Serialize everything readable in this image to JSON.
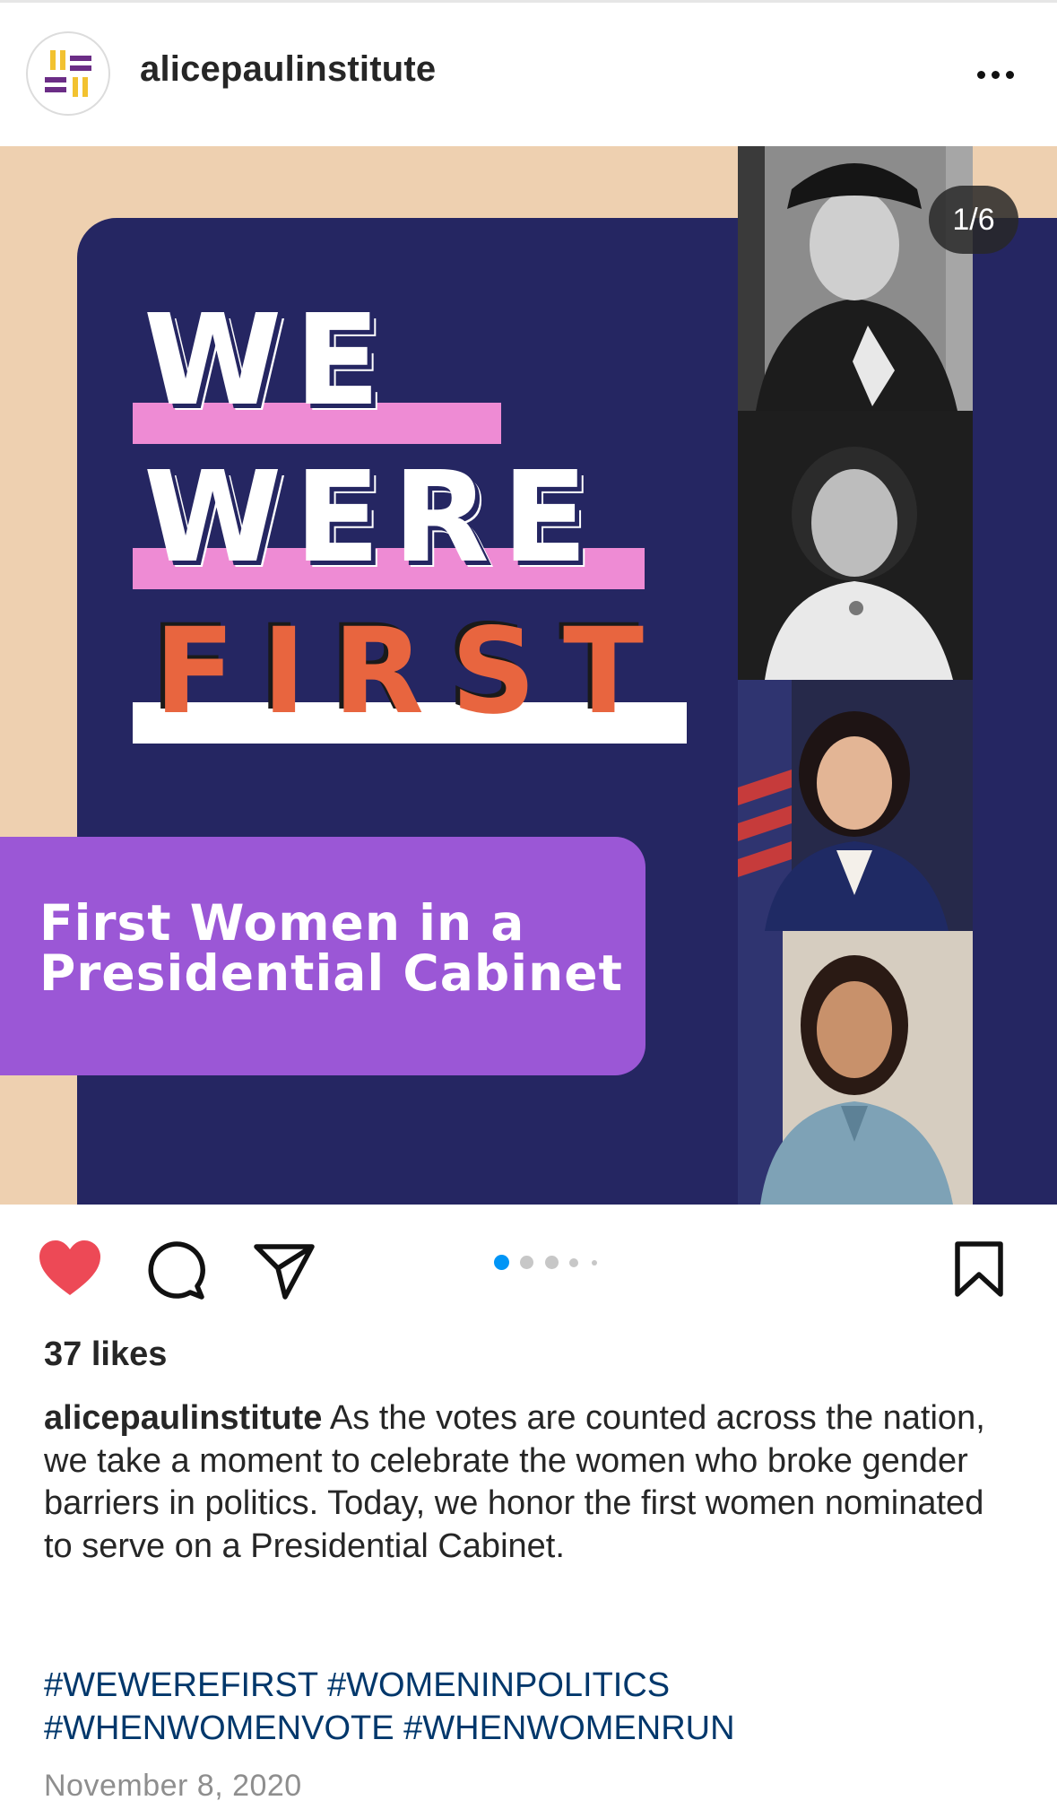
{
  "account": {
    "username": "alicepaulinstitute"
  },
  "post": {
    "slide_counter": "1/6",
    "current_slide": 1,
    "slide_count": 6,
    "headline_lines": [
      "WE",
      "WERE",
      "FIRST"
    ],
    "subtitle_lines": [
      "First Women in a",
      "Presidential Cabinet"
    ],
    "colors": {
      "background": "#eed0b0",
      "navy": "#252662",
      "pink": "#ee8bd4",
      "orange": "#e8653f",
      "purple": "#9b57d6"
    }
  },
  "actions": {
    "like_icon": "heart-filled-icon",
    "comment_icon": "comment-icon",
    "share_icon": "paper-plane-icon",
    "save_icon": "bookmark-icon",
    "liked": true
  },
  "likes_text": "37 likes",
  "caption": {
    "username": "alicepaulinstitute",
    "text": " As the votes are counted across the nation, we take a moment to celebrate the women who broke gender barriers in politics. Today, we honor the first women nominated to serve on a Presidential Cabinet."
  },
  "hashtags": [
    "#WEWEREFIRST",
    "#WOMENINPOLITICS",
    "#WHENWOMENVOTE",
    "#WHENWOMENRUN"
  ],
  "date": "November 8, 2020"
}
